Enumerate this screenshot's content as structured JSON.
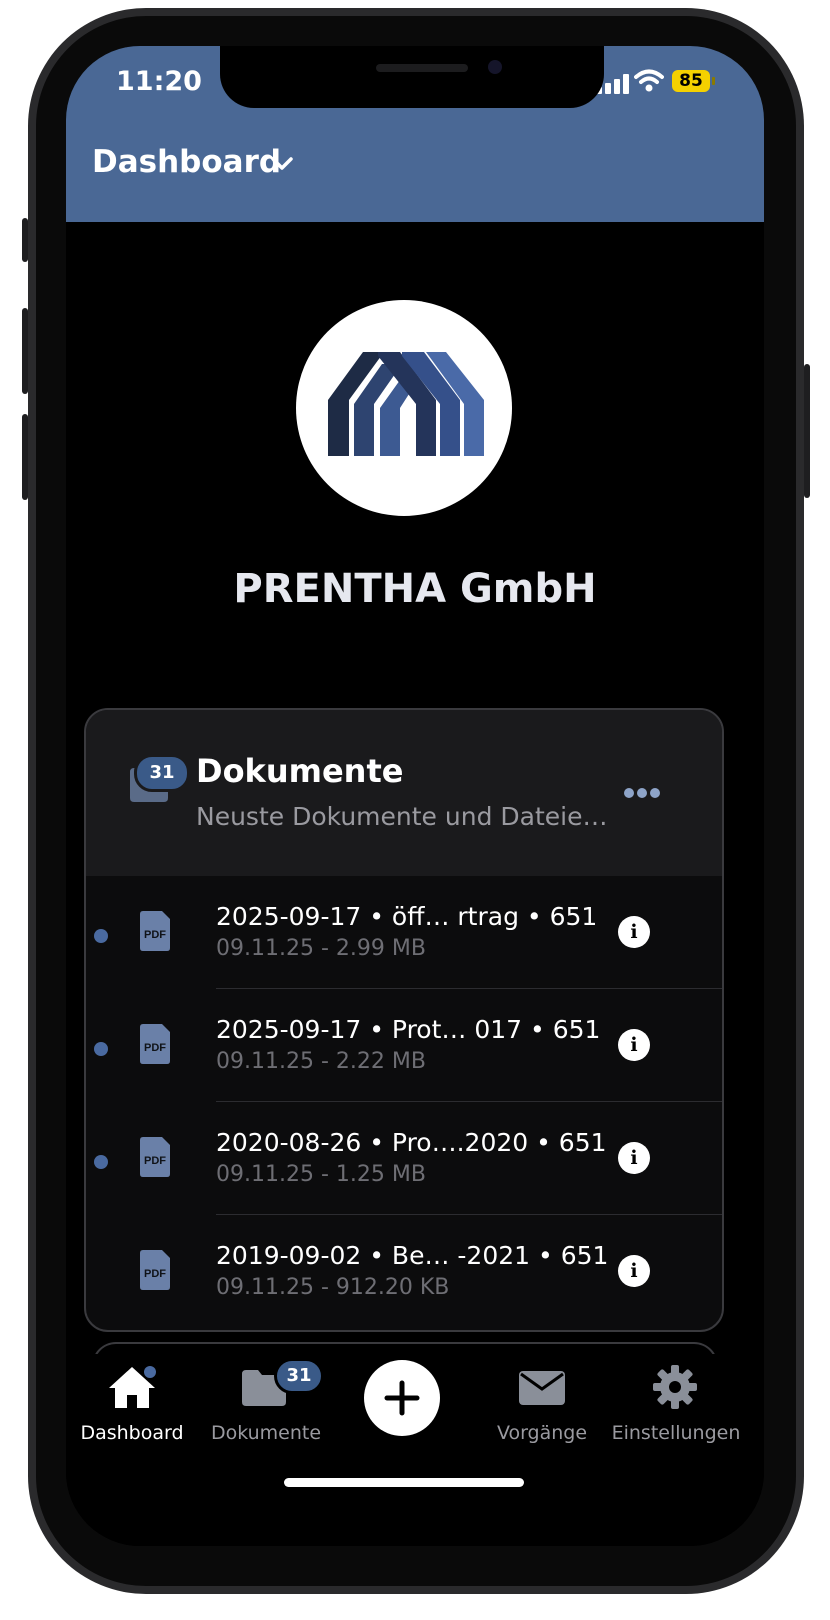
{
  "status_bar": {
    "time": "11:20",
    "battery": "85",
    "icons": [
      "signal-icon",
      "wifi-icon",
      "battery-icon"
    ]
  },
  "header": {
    "title": "Dashboard",
    "dropdown_icon": "chevron-down-icon"
  },
  "company": {
    "logo_icon": "company-logo",
    "name": "PRENTHA GmbH"
  },
  "documents_card": {
    "badge_count": "31",
    "title": "Dokumente",
    "subtitle": "Neuste Dokumente und Dateie…",
    "menu_icon": "more-icon",
    "items": [
      {
        "title": "2025-09-17 • öff…  rtrag  • 651",
        "meta": "09.11.25 - 2.99 MB",
        "unread": true
      },
      {
        "title": "2025-09-17 • Prot…  017 • 651",
        "meta": "09.11.25 - 2.22 MB",
        "unread": true
      },
      {
        "title": "2020-08-26 • Pro….2020 • 651",
        "meta": "09.11.25 - 1.25 MB",
        "unread": true
      },
      {
        "title": "2019-09-02 • Be… -2021  • 651",
        "meta": "09.11.25 - 912.20 KB",
        "unread": false
      }
    ]
  },
  "tab_bar": {
    "tabs": [
      {
        "label": "Dashboard",
        "icon": "home-icon",
        "active": true
      },
      {
        "label": "Dokumente",
        "icon": "folder-icon",
        "badge": "31"
      },
      {
        "label": "",
        "icon": "plus-icon"
      },
      {
        "label": "Vorgänge",
        "icon": "envelope-icon"
      },
      {
        "label": "Einstellungen",
        "icon": "gear-icon"
      }
    ]
  },
  "colors": {
    "header": "#4a6895",
    "accent": "#3a5a88",
    "background": "#000000"
  }
}
